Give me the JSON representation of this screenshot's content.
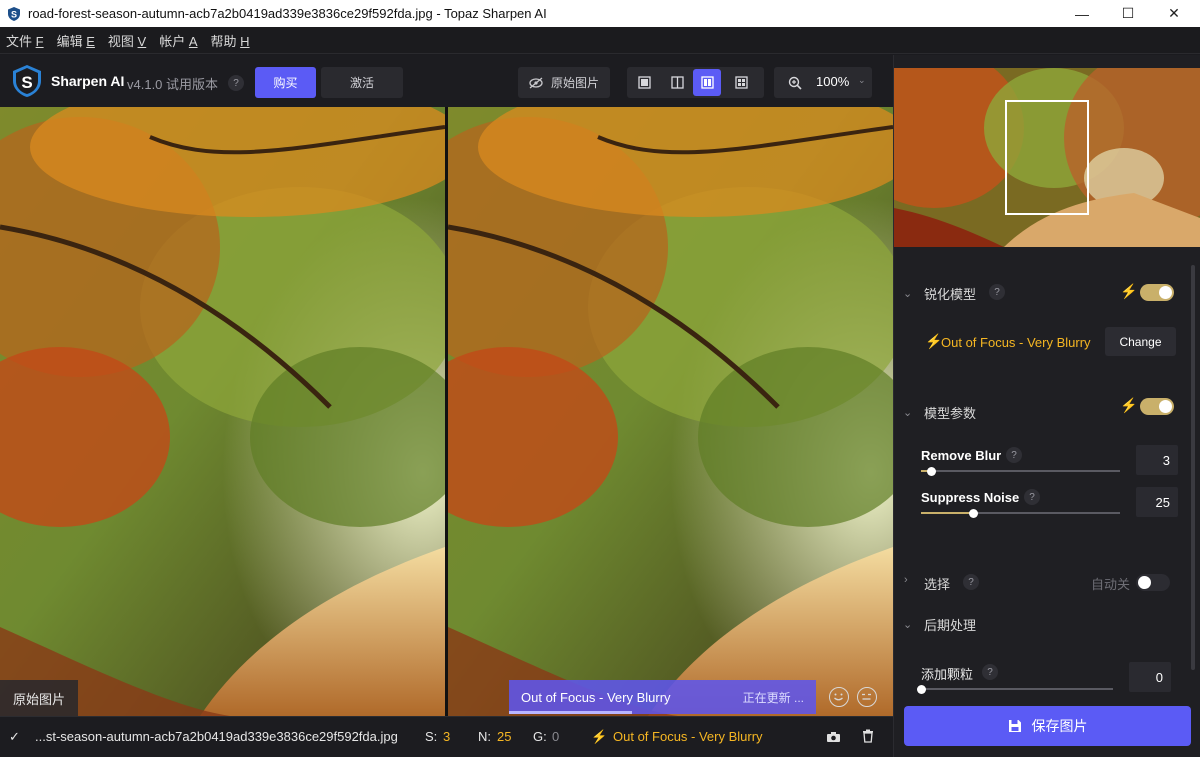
{
  "window": {
    "title": "road-forest-season-autumn-acb7a2b0419ad339e3836ce29f592fda.jpg - Topaz Sharpen AI",
    "minimize": "—",
    "maximize": "☐",
    "close": "✕"
  },
  "menu": [
    {
      "label": "文件",
      "key": "F"
    },
    {
      "label": "编辑",
      "key": "E"
    },
    {
      "label": "视图",
      "key": "V"
    },
    {
      "label": "帐户",
      "key": "A"
    },
    {
      "label": "帮助",
      "key": "H"
    }
  ],
  "toolbar": {
    "app_name": "Sharpen AI",
    "version": "v4.1.0 试用版本",
    "help": "?",
    "buy": "购买",
    "activate": "激活",
    "original": "原始图片",
    "zoom": "100%"
  },
  "preview": {
    "original_label": "原始图片",
    "model_chip": "Out of Focus - Very Blurry",
    "updating": "正在更新 ...",
    "progress": 0.4
  },
  "statusbar": {
    "filename": "...st-season-autumn-acb7a2b0419ad339e3836ce29f592fda.jpg",
    "s_label": "S:",
    "s_value": "3",
    "n_label": "N:",
    "n_value": "25",
    "g_label": "G:",
    "g_value": "0",
    "model": "Out of Focus - Very Blurry"
  },
  "panel": {
    "sharpen_model": {
      "title": "锐化模型",
      "help": "?",
      "enabled": true,
      "model": "Out of Focus - Very Blurry",
      "change": "Change"
    },
    "model_params": {
      "title": "模型参数",
      "enabled": true,
      "remove_blur": {
        "label": "Remove Blur",
        "help": "?",
        "value": "3",
        "level": 0.05
      },
      "suppress_noise": {
        "label": "Suppress Noise",
        "help": "?",
        "value": "25",
        "level": 0.26
      }
    },
    "selection": {
      "title": "选择",
      "help": "?",
      "auto_label": "自动关",
      "enabled": false
    },
    "post_processing": {
      "title": "后期处理",
      "add_grain": {
        "label": "添加颗粒",
        "help": "?",
        "value": "0",
        "level": 0.0
      }
    },
    "save": "保存图片"
  },
  "colors": {
    "accent": "#5b5bf5",
    "toggle_on": "#c9b06a",
    "bolt": "#f5b623"
  }
}
